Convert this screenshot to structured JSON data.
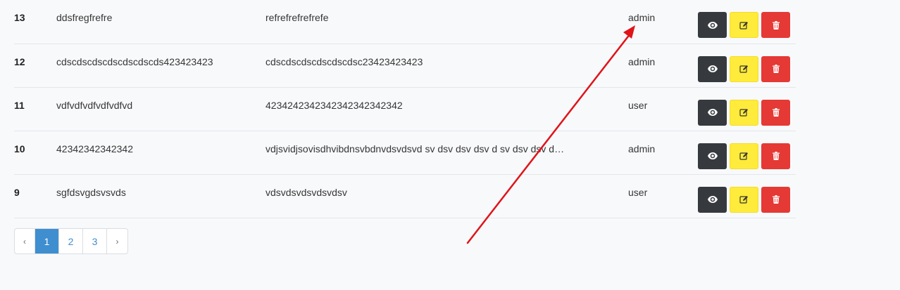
{
  "table": {
    "rows": [
      {
        "id": "13",
        "name": "ddsfregfrefre",
        "description": "refrefrefrefrefe",
        "role": "admin"
      },
      {
        "id": "12",
        "name": "cdscdscdscdscdscdscds423423423",
        "description": "cdscdscdscdscdscdsc23423423423",
        "role": "admin"
      },
      {
        "id": "11",
        "name": "vdfvdfvdfvdfvdfvd",
        "description": "4234242342342342342342342",
        "role": "user"
      },
      {
        "id": "10",
        "name": "42342342342342",
        "description": "vdjsvidjsovisdhvibdnsvbdnvdsvdsvd sv dsv dsv dsv d sv dsv dsv dsv dsv",
        "role": "admin"
      },
      {
        "id": "9",
        "name": "sgfdsvgdsvsvds",
        "description": "vdsvdsvdsvdsvdsv",
        "role": "user"
      }
    ],
    "actions": {
      "view_icon": "eye-icon",
      "edit_icon": "edit-icon",
      "delete_icon": "trash-icon"
    }
  },
  "pagination": {
    "prev": "‹",
    "pages": [
      "1",
      "2",
      "3"
    ],
    "active_page": "1",
    "next": "›"
  },
  "colors": {
    "view_button": "#363a3f",
    "edit_button": "#ffeb3b",
    "delete_button": "#e53935",
    "active_page": "#3e8ed0",
    "annotation_arrow": "#e0141a"
  }
}
